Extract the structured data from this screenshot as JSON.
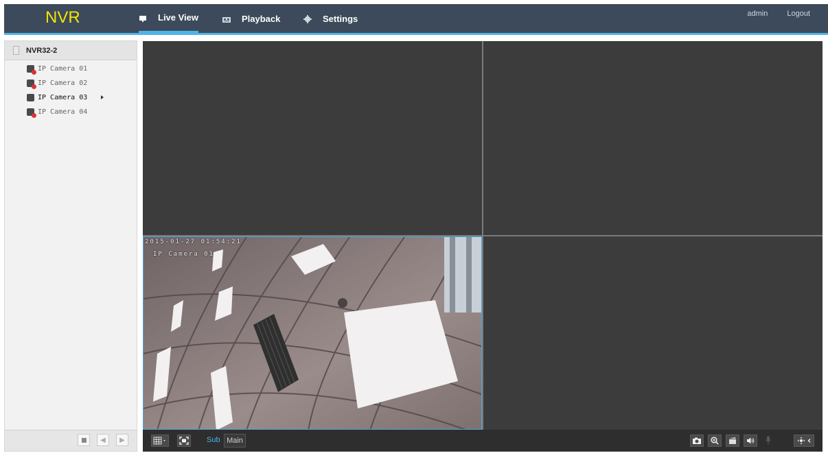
{
  "app": {
    "logo": "NVR"
  },
  "nav": {
    "live_view": "Live View",
    "playback": "Playback",
    "settings": "Settings"
  },
  "user": {
    "name": "admin",
    "logout": "Logout"
  },
  "sidebar": {
    "device": "NVR32-2",
    "cameras": [
      {
        "label": "IP Camera 01",
        "status": "offline"
      },
      {
        "label": "IP Camera 02",
        "status": "offline"
      },
      {
        "label": "IP Camera 03",
        "status": "online"
      },
      {
        "label": "IP Camera 04",
        "status": "offline"
      }
    ]
  },
  "video": {
    "timestamp": "2015-01-27 01:54:21",
    "camera_name": "IP Camera 01"
  },
  "toolbar": {
    "sub": "Sub",
    "main": "Main"
  },
  "colors": {
    "header_bg": "#3c4a5b",
    "accent": "#4fb3e8",
    "logo": "#f5e500",
    "pane_bg": "#3c3c3c"
  },
  "icons": [
    "monitor-icon",
    "playback-icon",
    "gear-icon",
    "device-icon",
    "camera-icon",
    "stop-icon",
    "prev-icon",
    "next-icon",
    "layout-icon",
    "fullscreen-icon",
    "snapshot-icon",
    "zoom-icon",
    "record-icon",
    "audio-icon",
    "microphone-icon",
    "ptz-icon"
  ]
}
